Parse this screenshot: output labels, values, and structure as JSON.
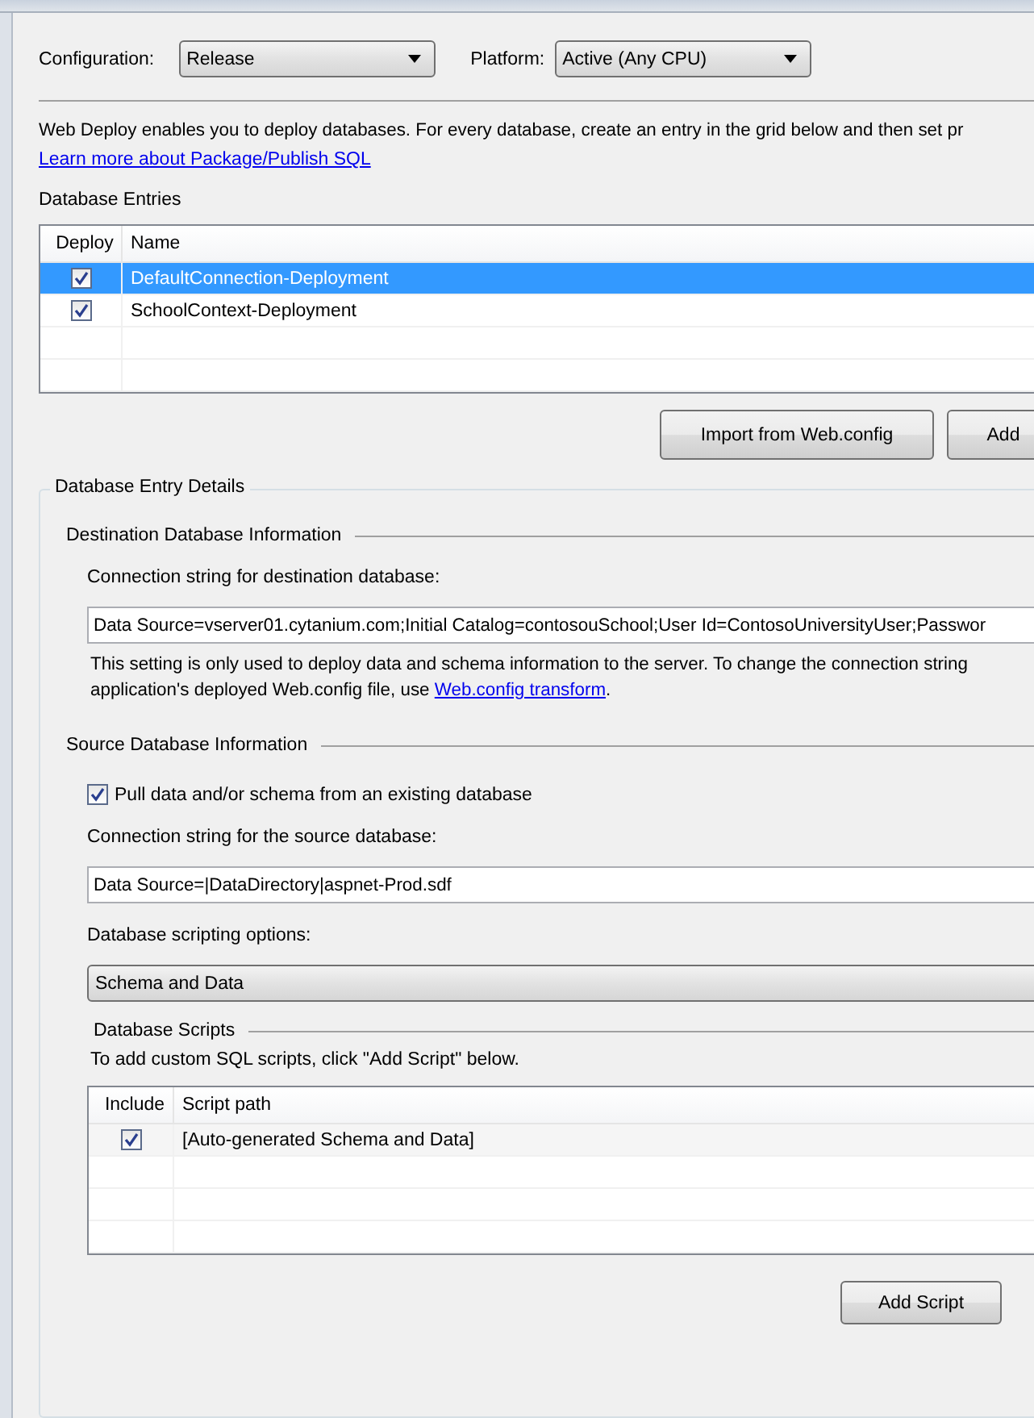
{
  "configuration": {
    "label": "Configuration:",
    "value": "Release"
  },
  "platform": {
    "label": "Platform:",
    "value": "Active (Any CPU)"
  },
  "description": "Web Deploy enables you to deploy databases. For every database, create an entry in the grid below and then set pr",
  "learn_more_link": "Learn more about Package/Publish SQL",
  "database_entries": {
    "title": "Database Entries",
    "columns": [
      "Deploy",
      "Name"
    ],
    "rows": [
      {
        "deploy": true,
        "name": "DefaultConnection-Deployment",
        "selected": true
      },
      {
        "deploy": true,
        "name": "SchoolContext-Deployment",
        "selected": false
      }
    ]
  },
  "buttons": [
    "Import from Web.config",
    "Add"
  ],
  "details": {
    "title": "Database Entry Details",
    "destination": {
      "title": "Destination Database Information",
      "connection_label": "Connection string for destination database:",
      "connection_value": "Data Source=vserver01.cytanium.com;Initial Catalog=contosouSchool;User Id=ContosoUniversityUser;Passwor",
      "note": {
        "line_1": "This setting is only used to deploy data and schema information to the server. To change the connection string",
        "line_2": "application's deployed Web.config file, use ",
        "link": "Web.config transform",
        "after_link": "."
      }
    },
    "source": {
      "title": "Source Database Information",
      "pull_checkbox": {
        "label": "Pull data and/or schema from an existing database",
        "checked": true
      },
      "connection_label": "Connection string for the source database:",
      "connection_value": "Data Source=|DataDirectory|aspnet-Prod.sdf",
      "scripting_label": "Database scripting options:",
      "scripting_value": "Schema and Data"
    },
    "scripts": {
      "title": "Database Scripts",
      "hint": "To add custom SQL scripts, click \"Add Script\" below.",
      "columns": [
        "Include",
        "Script path"
      ],
      "rows": [
        {
          "include": true,
          "path": "[Auto-generated Schema and Data]"
        }
      ],
      "add_button": "Add Script"
    }
  }
}
